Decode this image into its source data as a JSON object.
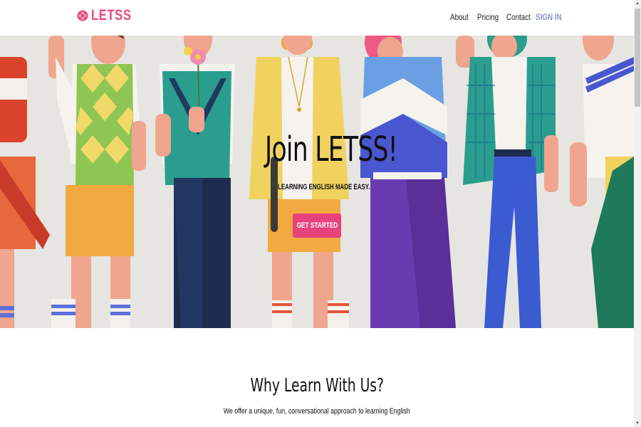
{
  "brand": {
    "name": "LETSS",
    "color": "#e7467e",
    "icon": "flower-icon"
  },
  "nav": {
    "items": [
      {
        "label": "About"
      },
      {
        "label": "Pricing"
      },
      {
        "label": "Contact"
      },
      {
        "label": "SIGN IN"
      }
    ]
  },
  "hero": {
    "title": "Join LETSS!",
    "subtitle": "LEARNING ENGLISH MADE EASY.",
    "cta_label": "GET STARTED",
    "background_color": "#e6e5e1",
    "cta_color": "#e8427c"
  },
  "why": {
    "title": "Why Learn With Us?",
    "subtitle": "We offer a unique, fun, conversational approach to learning English"
  }
}
